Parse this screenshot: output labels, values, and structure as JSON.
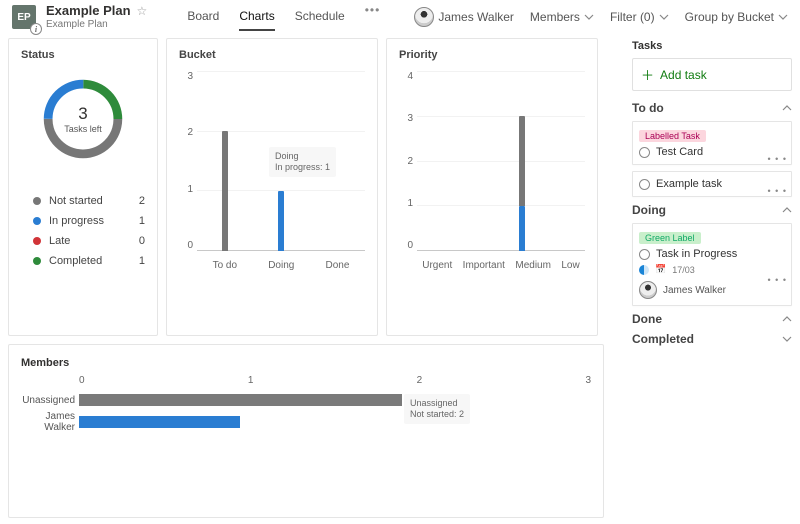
{
  "colors": {
    "notstarted": "#777777",
    "inprogress": "#2a7dd2",
    "late": "#d13438",
    "completed": "#2e8b3b",
    "medium": "#ffb900",
    "members_bar1": "#7a7a7a",
    "members_bar2": "#2a7dd2"
  },
  "plan": {
    "badge": "EP",
    "title": "Example Plan",
    "subtitle": "Example Plan"
  },
  "tabs": {
    "board": "Board",
    "charts": "Charts",
    "schedule": "Schedule"
  },
  "header": {
    "user": "James Walker",
    "members": "Members",
    "filter": "Filter (0)",
    "groupby": "Group by Bucket"
  },
  "status": {
    "title": "Status",
    "center_value": "3",
    "center_label": "Tasks left",
    "legend": [
      {
        "label": "Not started",
        "value": "2",
        "color": "notstarted"
      },
      {
        "label": "In progress",
        "value": "1",
        "color": "inprogress"
      },
      {
        "label": "Late",
        "value": "0",
        "color": "late"
      },
      {
        "label": "Completed",
        "value": "1",
        "color": "completed"
      }
    ]
  },
  "bucket": {
    "title": "Bucket",
    "ymax": 3,
    "ticks": [
      "3",
      "2",
      "1",
      "0"
    ],
    "data": [
      {
        "label": "To do",
        "value": 2,
        "color": "notstarted"
      },
      {
        "label": "Doing",
        "value": 1,
        "color": "inprogress"
      },
      {
        "label": "Done",
        "value": 0,
        "color": "notstarted"
      }
    ],
    "tooltip_title": "Doing",
    "tooltip_line": "In progress: 1"
  },
  "priority": {
    "title": "Priority",
    "ymax": 4,
    "ticks": [
      "4",
      "3",
      "2",
      "1",
      "0"
    ],
    "data": [
      {
        "label": "Urgent",
        "value": 0,
        "color": "notstarted"
      },
      {
        "label": "Important",
        "value": 0,
        "color": "notstarted"
      },
      {
        "label": "Medium",
        "value": 3,
        "color_stack": [
          {
            "c": "notstarted",
            "v": 2
          },
          {
            "c": "inprogress",
            "v": 1
          }
        ]
      },
      {
        "label": "Low",
        "value": 0,
        "color": "notstarted"
      }
    ]
  },
  "members": {
    "title": "Members",
    "xmax": 3,
    "ticks": [
      "0",
      "1",
      "2",
      "3"
    ],
    "rows": [
      {
        "label": "Unassigned",
        "value": 2,
        "color": "members_bar1"
      },
      {
        "label": "James Walker",
        "value": 1,
        "color": "members_bar2"
      }
    ],
    "tooltip_title": "Unassigned",
    "tooltip_line": "Not started: 2"
  },
  "chart_data": [
    {
      "type": "pie",
      "title": "Status",
      "series": [
        {
          "name": "Not started",
          "value": 2
        },
        {
          "name": "In progress",
          "value": 1
        },
        {
          "name": "Late",
          "value": 0
        },
        {
          "name": "Completed",
          "value": 1
        }
      ],
      "center_label": "3 Tasks left"
    },
    {
      "type": "bar",
      "title": "Bucket",
      "categories": [
        "To do",
        "Doing",
        "Done"
      ],
      "values": [
        2,
        1,
        0
      ],
      "ylim": [
        0,
        3
      ]
    },
    {
      "type": "bar",
      "title": "Priority",
      "categories": [
        "Urgent",
        "Important",
        "Medium",
        "Low"
      ],
      "series": [
        {
          "name": "Not started",
          "values": [
            0,
            0,
            2,
            0
          ]
        },
        {
          "name": "In progress",
          "values": [
            0,
            0,
            1,
            0
          ]
        }
      ],
      "ylim": [
        0,
        4
      ]
    },
    {
      "type": "bar",
      "orientation": "horizontal",
      "title": "Members",
      "categories": [
        "Unassigned",
        "James Walker"
      ],
      "values": [
        2,
        1
      ],
      "xlim": [
        0,
        3
      ]
    }
  ],
  "side": {
    "tasks_label": "Tasks",
    "add_task": "Add task",
    "sections": {
      "todo": "To do",
      "doing": "Doing",
      "done": "Done",
      "completed": "Completed"
    },
    "todo_cards": [
      {
        "label": "Labelled Task",
        "pill": "pink",
        "title": "Test Card"
      },
      {
        "title": "Example task"
      }
    ],
    "doing_card": {
      "label": "Green Label",
      "pill": "green",
      "title": "Task in Progress",
      "date": "17/03",
      "assignee": "James Walker"
    }
  }
}
